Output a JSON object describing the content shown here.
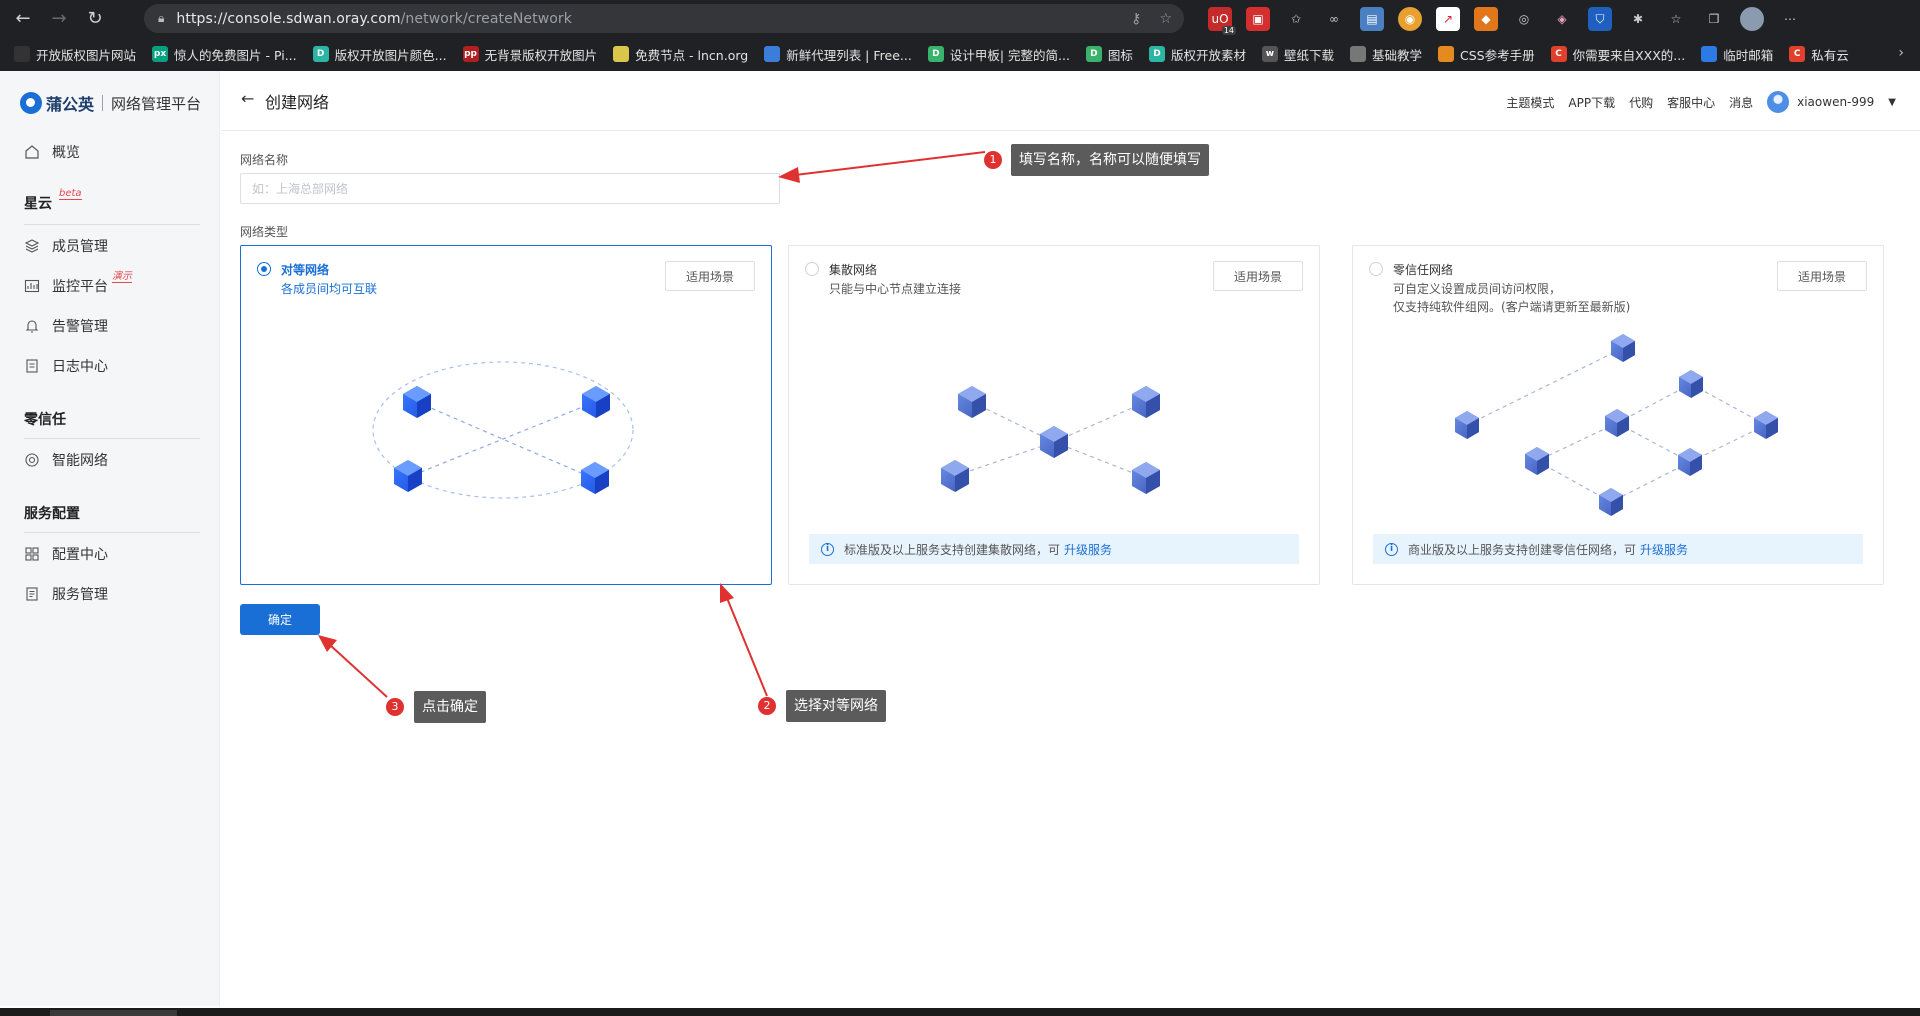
{
  "browser": {
    "url_host": "https://console.sdwan.oray.com",
    "url_path": "/network/createNetwork",
    "ext_badge": "14"
  },
  "bookmarks": [
    {
      "label": "开放版权图片网站",
      "icon_color": "#333"
    },
    {
      "label": "惊人的免费图片 - Pi...",
      "icon_color": "#05a081",
      "icon_text": "px"
    },
    {
      "label": "版权开放图片颜色...",
      "icon_color": "#2bb5a2",
      "icon_text": "D"
    },
    {
      "label": "无背景版权开放图片",
      "icon_color": "#b02020",
      "icon_text": "pp"
    },
    {
      "label": "免费节点 - lncn.org",
      "icon_color": "#d9c64a"
    },
    {
      "label": "新鲜代理列表 | Free...",
      "icon_color": "#3b7dd8"
    },
    {
      "label": "设计甲板| 完整的简...",
      "icon_color": "#39b26b",
      "icon_text": "D"
    },
    {
      "label": "图标",
      "icon_color": "#39b26b",
      "icon_text": "D"
    },
    {
      "label": "版权开放素材",
      "icon_color": "#2bb5a2",
      "icon_text": "D"
    },
    {
      "label": "壁纸下载",
      "icon_color": "#555",
      "icon_text": "w"
    },
    {
      "label": "基础教学",
      "icon_color": "#777"
    },
    {
      "label": "CSS参考手册",
      "icon_color": "#e58a1f"
    },
    {
      "label": "你需要来自XXX的...",
      "icon_color": "#e0402c",
      "icon_text": "C"
    },
    {
      "label": "临时邮箱",
      "icon_color": "#2c7be5"
    },
    {
      "label": "私有云",
      "icon_color": "#e0402c",
      "icon_text": "C"
    }
  ],
  "sidebar": {
    "brand": "蒲公英",
    "subtitle": "网络管理平台",
    "overview": "概览",
    "section_xingyun": "星云",
    "beta_tag": "beta",
    "members": "成员管理",
    "monitor": "监控平台",
    "demo_tag": "演示",
    "alerts": "告警管理",
    "logs": "日志中心",
    "section_zerotrust": "零信任",
    "smart_network": "智能网络",
    "section_service": "服务配置",
    "config_center": "配置中心",
    "service_mgmt": "服务管理"
  },
  "header": {
    "title": "创建网络",
    "links": [
      "主题模式",
      "APP下载",
      "代购",
      "客服中心",
      "消息"
    ],
    "username": "xiaowen-999"
  },
  "form": {
    "name_label": "网络名称",
    "name_placeholder": "如：上海总部网络",
    "name_value": "",
    "type_label": "网络类型",
    "confirm": "确定"
  },
  "cards": [
    {
      "title": "对等网络",
      "desc1": "各成员间均可互联",
      "desc2": "",
      "button": "适用场景",
      "selected": true
    },
    {
      "title": "集散网络",
      "desc1": "只能与中心节点建立连接",
      "desc2": "",
      "button": "适用场景",
      "selected": false,
      "notice": "标准版及以上服务支持创建集散网络，可",
      "notice_link": "升级服务"
    },
    {
      "title": "零信任网络",
      "desc1": "可自定义设置成员间访问权限，",
      "desc2": "仅支持纯软件组网。(客户端请更新至最新版)",
      "button": "适用场景",
      "selected": false,
      "notice": "商业版及以上服务支持创建零信任网络，可",
      "notice_link": "升级服务"
    }
  ],
  "annotations": [
    {
      "num": "1",
      "text": "填写名称，名称可以随便填写"
    },
    {
      "num": "2",
      "text": "选择对等网络"
    },
    {
      "num": "3",
      "text": "点击确定"
    }
  ],
  "colors": {
    "accent": "#1a6fd6",
    "annotation": "#e03131"
  }
}
